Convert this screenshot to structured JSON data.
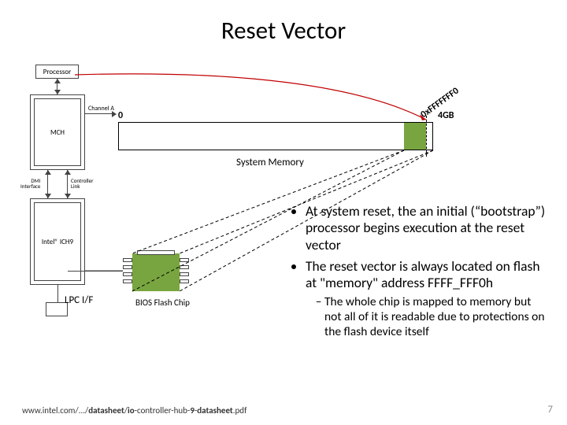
{
  "title": "Reset Vector",
  "hw": {
    "processor": "Processor",
    "channelA": "Channel A",
    "mch": "MCH",
    "dmi": "DMI\nInterface",
    "ctrlink": "Controller\nLink",
    "ich9": "Intel® ICH9",
    "lpc": "LPC I/F",
    "bioschip": "BIOS Flash Chip"
  },
  "mem": {
    "zero": "0",
    "max": "4GB",
    "label": "System Memory",
    "resetvec": "0xFFFFFFF0"
  },
  "bullets": {
    "b1": "At system reset, the an initial (“bootstrap”) processor begins execution at the reset vector",
    "b2": "The reset vector is always located on flash at \"memory\" address FFFF_FFF0h",
    "b2a": "The whole chip is mapped to memory but not all of it is readable due to protections on the flash device itself"
  },
  "footer": {
    "pre": "www.intel.com/.../",
    "bold1": "datasheet",
    "mid": "/",
    "bold2": "io",
    "post1": "-controller-hub-",
    "bold3": "9",
    "post2": "-",
    "bold4": "datasheet",
    "post3": ".pdf"
  },
  "page": "7"
}
